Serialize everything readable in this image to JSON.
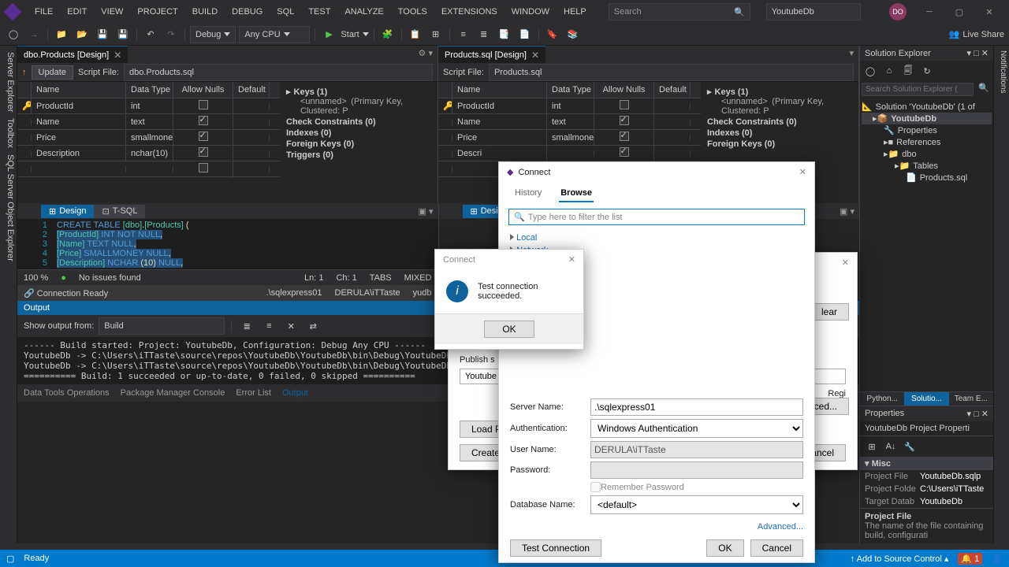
{
  "menu": [
    "FILE",
    "EDIT",
    "VIEW",
    "PROJECT",
    "BUILD",
    "DEBUG",
    "SQL",
    "TEST",
    "ANALYZE",
    "TOOLS",
    "EXTENSIONS",
    "WINDOW",
    "HELP"
  ],
  "search_placeholder": "Search",
  "config": "YoutubeDb",
  "avatar": "DO",
  "toolbar": {
    "debug": "Debug",
    "cpu": "Any CPU",
    "start": "Start",
    "liveshare": "Live Share"
  },
  "leftRail": [
    "Server Explorer",
    "Toolbox",
    "SQL Server Object Explorer"
  ],
  "docTabs": [
    {
      "label": "dbo.Products [Design]",
      "active": true
    },
    {
      "label": "Products.sql [Design]",
      "active": true
    }
  ],
  "updateBtn": "Update",
  "scriptFileLabel": "Script File:",
  "scriptFile1": "dbo.Products.sql",
  "scriptFile2": "Products.sql",
  "gridHeaders": {
    "name": "Name",
    "type": "Data Type",
    "nulls": "Allow Nulls",
    "def": "Default"
  },
  "rows1": [
    {
      "name": "ProductId",
      "type": "int",
      "nulls": false,
      "key": true
    },
    {
      "name": "Name",
      "type": "text",
      "nulls": true
    },
    {
      "name": "Price",
      "type": "smallmoney",
      "nulls": true
    },
    {
      "name": "Description",
      "type": "nchar(10)",
      "nulls": true
    }
  ],
  "rows2": [
    {
      "name": "ProductId",
      "type": "int",
      "nulls": false,
      "key": true
    },
    {
      "name": "Name",
      "type": "text",
      "nulls": true
    },
    {
      "name": "Price",
      "type": "smallmoney",
      "nulls": true
    },
    {
      "name": "Descri",
      "type": "",
      "nulls": true
    }
  ],
  "keys": {
    "keys": "Keys (1)",
    "unnamed": "<unnamed>",
    "unnamedDesc": "(Primary Key, Clustered: P",
    "check": "Check Constraints (0)",
    "indexes": "Indexes (0)",
    "fk": "Foreign Keys (0)",
    "triggers": "Triggers (0)"
  },
  "designTab": "Design",
  "tsqlTab": "T-SQL",
  "sql": [
    {
      "n": "1",
      "t": "CREATE TABLE [dbo].[Products] (",
      "cls": ""
    },
    {
      "n": "2",
      "t": "    [ProductId]   INT        NOT NULL,",
      "cls": "sel"
    },
    {
      "n": "3",
      "t": "    [Name]        TEXT       NULL,",
      "cls": "sel"
    },
    {
      "n": "4",
      "t": "    [Price]       SMALLMONEY NULL,",
      "cls": "sel"
    },
    {
      "n": "5",
      "t": "    [Description] NCHAR (10) NULL,",
      "cls": "sel"
    }
  ],
  "statusLine": {
    "pct": "100 %",
    "issues": "No issues found",
    "ln": "Ln: 1",
    "ch": "Ch: 1",
    "tabs": "TABS",
    "mixed": "MIXED"
  },
  "connLine": {
    "ready": "Connection Ready",
    "server": ".\\sqlexpress01",
    "user": "DERULA\\iTTaste",
    "db": "yudb"
  },
  "output": {
    "title": "Output",
    "showFrom": "Show output from:",
    "source": "Build",
    "lines": [
      "------ Build started: Project: YoutubeDb, Configuration: Debug Any CPU ------",
      "  YoutubeDb -> C:\\Users\\iTTaste\\source\\repos\\YoutubeDb\\YoutubeDb\\bin\\Debug\\YoutubeDb.dll",
      "  YoutubeDb -> C:\\Users\\iTTaste\\source\\repos\\YoutubeDb\\YoutubeDb\\bin\\Debug\\YoutubeDb.dacpac",
      "========== Build: 1 succeeded or up-to-date, 0 failed, 0 skipped =========="
    ]
  },
  "bottomTabs": [
    "Data Tools Operations",
    "Package Manager Console",
    "Error List",
    "Output"
  ],
  "solutionExplorer": {
    "title": "Solution Explorer",
    "searchPlaceholder": "Search Solution Explorer (",
    "root": "Solution 'YoutubeDb' (1 of",
    "proj": "YoutubeDb",
    "props": "Properties",
    "refs": "References",
    "dbo": "dbo",
    "tables": "Tables",
    "file": "Products.sql"
  },
  "rpTabs": [
    "Python...",
    "Solutio...",
    "Team E..."
  ],
  "properties": {
    "title": "Properties",
    "obj": "YoutubeDb Project Properti",
    "cat": "Misc",
    "rows": [
      {
        "k": "Project File",
        "v": "YoutubeDb.sqlp"
      },
      {
        "k": "Project Folde",
        "v": "C:\\Users\\iTTaste"
      },
      {
        "k": "Target Datab",
        "v": "YoutubeDb"
      }
    ],
    "descTitle": "Project File",
    "desc": "The name of the file containing build, configurati"
  },
  "statusbar": {
    "ready": "Ready",
    "addSrc": "Add to Source Control"
  },
  "connectDlg": {
    "title": "Connect",
    "history": "History",
    "browse": "Browse",
    "filterPlaceholder": "Type here to filter the list",
    "local": "Local",
    "network": "Network",
    "serverNameLbl": "Server Name:",
    "serverName": ".\\sqlexpress01",
    "authLbl": "Authentication:",
    "auth": "Windows Authentication",
    "userLbl": "User Name:",
    "user": "DERULA\\iTTaste",
    "pwdLbl": "Password:",
    "remember": "Remember Password",
    "dbLbl": "Database Name:",
    "db": "<default>",
    "advanced": "Advanced...",
    "test": "Test Connection",
    "ok": "OK",
    "cancel": "Cancel"
  },
  "msgDlg": {
    "title": "Connect",
    "text": "Test connection succeeded.",
    "ok": "OK"
  },
  "publishDlg": {
    "publishLbl": "Publish s",
    "youtube": "Youtube",
    "regi": "Regi",
    "loadPro": "Load Pro",
    "createPr": "Create Pr",
    "advanced": "anced...",
    "clear": "lear",
    "cancel": "Cancel"
  },
  "rightRail": "Notifications"
}
